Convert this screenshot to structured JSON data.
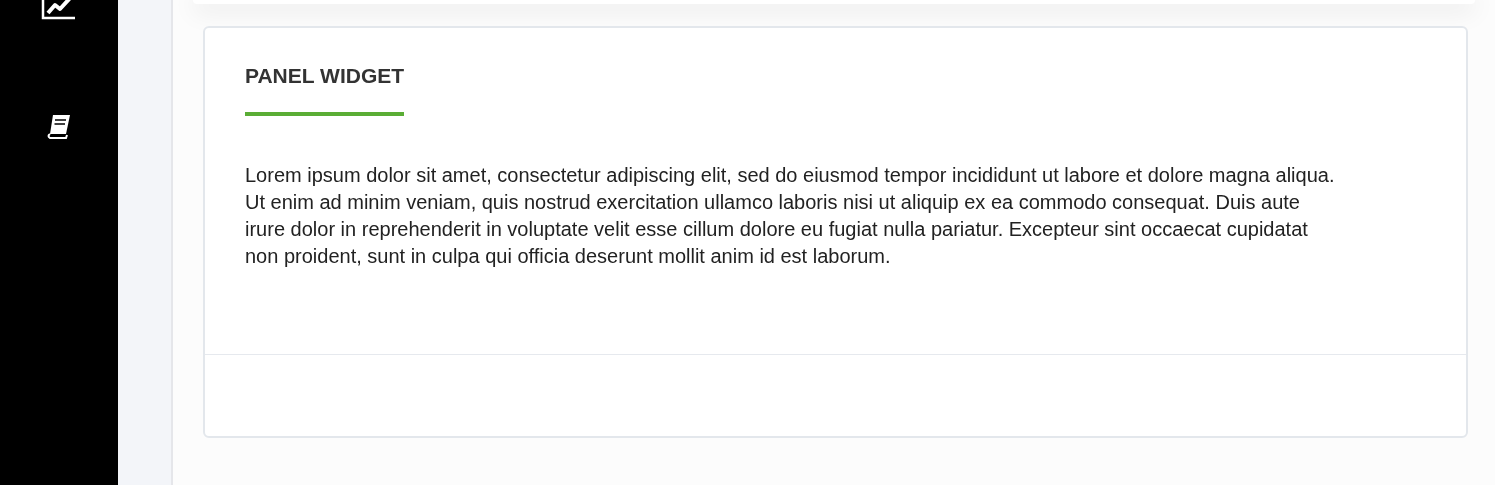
{
  "panel": {
    "title": "PANEL WIDGET",
    "body": "Lorem ipsum dolor sit amet, consectetur adipiscing elit, sed do eiusmod tempor incididunt ut labore et dolore magna aliqua. Ut enim ad minim veniam, quis nostrud exercitation ullamco laboris nisi ut aliquip ex ea commodo consequat. Duis aute irure dolor in reprehenderit in voluptate velit esse cillum dolore eu fugiat nulla pariatur. Excepteur sint occaecat cupidatat non proident, sunt in culpa qui officia deserunt mollit anim id est laborum."
  }
}
